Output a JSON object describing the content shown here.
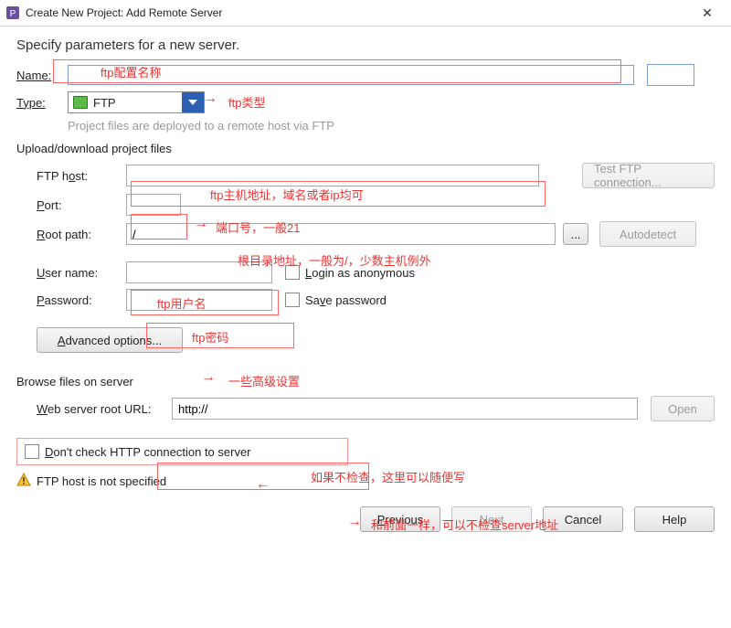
{
  "window": {
    "title": "Create New Project: Add Remote Server",
    "close_symbol": "✕"
  },
  "header": "Specify parameters for a new server.",
  "labels": {
    "name": "Name:",
    "type": "Type:",
    "type_value": "FTP",
    "deploy_hint": "Project files are deployed to a remote host via FTP",
    "section_upload": "Upload/download project files",
    "ftp_host_pre": "FTP h",
    "ftp_host_u": "o",
    "ftp_host_post": "st:",
    "port_u": "P",
    "port_post": "ort:",
    "root_u": "R",
    "root_post": "oot path:",
    "root_value": "/",
    "user_u": "U",
    "user_post": "ser name:",
    "pass_u": "P",
    "pass_post": "assword:",
    "login_anon_pre": "",
    "login_anon_u": "L",
    "login_anon_post": "ogin as anonymous",
    "save_pw_pre": "Sa",
    "save_pw_u": "v",
    "save_pw_post": "e password",
    "adv_u": "A",
    "adv_post": "dvanced options...",
    "section_browse": "Browse files on server",
    "web_u": "W",
    "web_post": "eb server root URL:",
    "web_value": "http://",
    "dont_check_u": "D",
    "dont_check_post": "on't check HTTP connection to server",
    "warn": "FTP host is not specified"
  },
  "buttons": {
    "test_ftp": "Test FTP connection...",
    "dots": "...",
    "autodetect": "Autodetect",
    "open": "Open",
    "previous_u": "P",
    "previous_post": "revious",
    "next_u": "N",
    "next_post": "ext",
    "cancel": "Cancel",
    "help": "Help"
  },
  "annotations": {
    "name": "ftp配置名称",
    "type": "ftp类型",
    "host": "ftp主机地址，域名或者ip均可",
    "port": "端口号，一般21",
    "root": "根目录地址，一般为/，少数主机例外",
    "user": "ftp用户名",
    "pass": "ftp密码",
    "adv": "一些高级设置",
    "web": "如果不检查，这里可以随便写",
    "dont": "和前面一样，可以不检查server地址"
  }
}
